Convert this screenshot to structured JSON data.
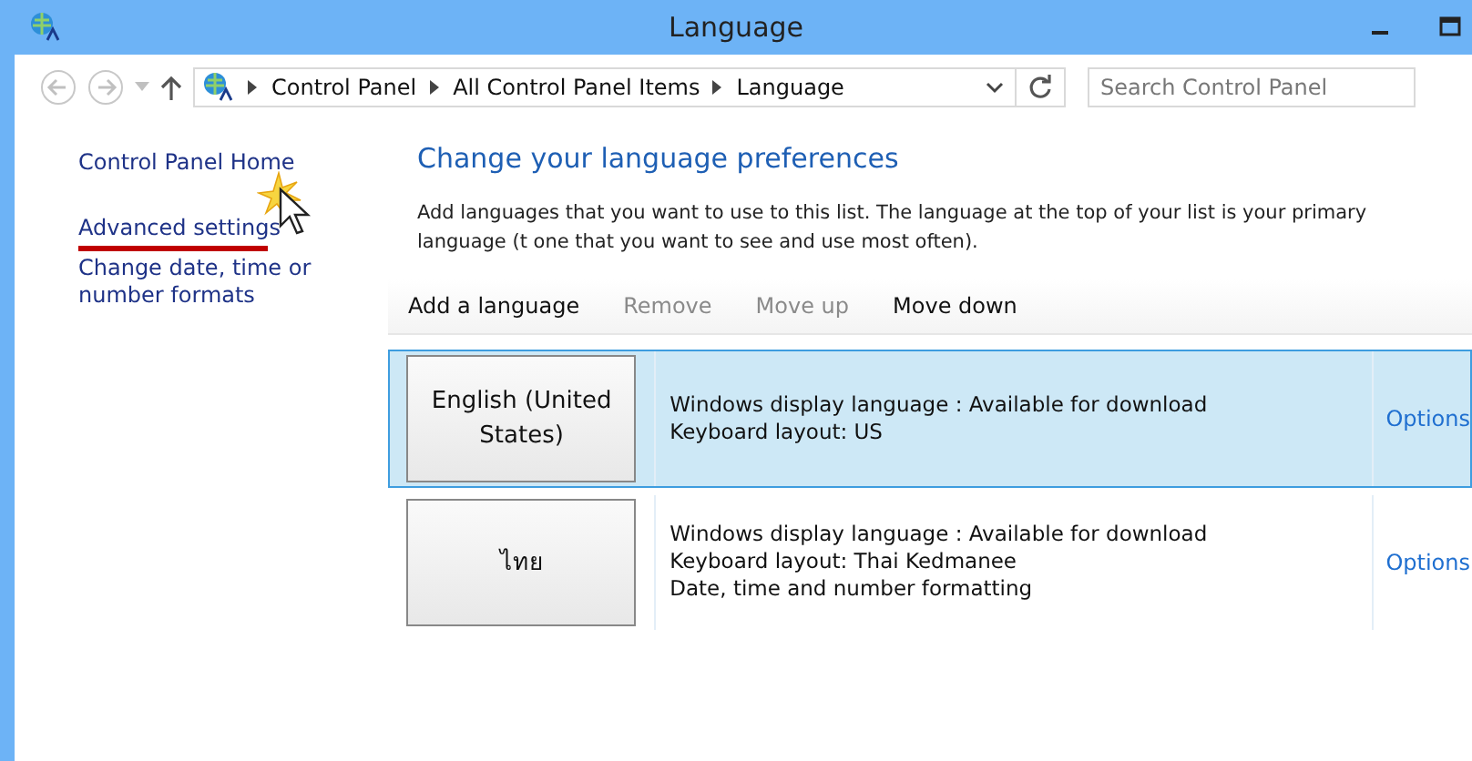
{
  "window": {
    "title": "Language"
  },
  "address_bar": {
    "breadcrumbs": [
      "Control Panel",
      "All Control Panel Items",
      "Language"
    ]
  },
  "search": {
    "placeholder": "Search Control Panel"
  },
  "sidebar": {
    "items": [
      "Control Panel Home",
      "Advanced settings",
      "Change date, time or number formats"
    ]
  },
  "main": {
    "heading": "Change your language preferences",
    "description": "Add languages that you want to use to this list. The language at the top of your list is your primary language (t one that you want to see and use most often).",
    "toolbar": [
      {
        "label": "Add a language",
        "disabled": false
      },
      {
        "label": "Remove",
        "disabled": true
      },
      {
        "label": "Move up",
        "disabled": true
      },
      {
        "label": "Move down",
        "disabled": false
      }
    ],
    "languages": [
      {
        "name": "English (United States)",
        "selected": true,
        "details": [
          "Windows display language : Available for download",
          "Keyboard layout: US"
        ],
        "action": "Options"
      },
      {
        "name": "ไทย",
        "selected": false,
        "details": [
          "Windows display language : Available for download",
          "Keyboard layout: Thai Kedmanee",
          "Date, time and number formatting"
        ],
        "action": "Options"
      }
    ]
  }
}
